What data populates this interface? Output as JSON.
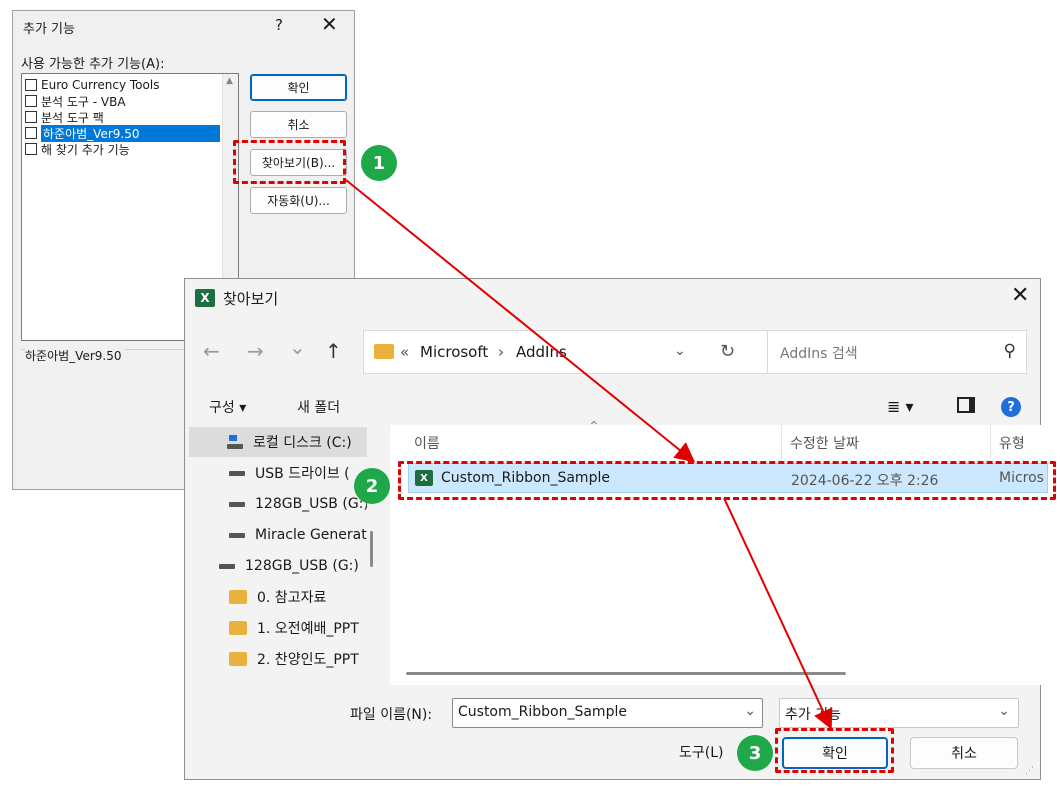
{
  "addins_dialog": {
    "title": "추가 기능",
    "help_symbol": "?",
    "close_symbol": "✕",
    "list_label": "사용 가능한 추가 기능(A):",
    "items": [
      {
        "label": "Euro Currency Tools",
        "checked": false,
        "selected": false
      },
      {
        "label": "분석 도구 - VBA",
        "checked": false,
        "selected": false
      },
      {
        "label": "분석 도구 팩",
        "checked": false,
        "selected": false
      },
      {
        "label": "하준아범_Ver9.50",
        "checked": false,
        "selected": true
      },
      {
        "label": "해 찾기 추가 기능",
        "checked": false,
        "selected": false
      }
    ],
    "description": "하준아범_Ver9.50",
    "buttons": {
      "ok": "확인",
      "cancel": "취소",
      "browse": "찾아보기(B)...",
      "automation": "자동화(U)..."
    }
  },
  "browse_dialog": {
    "title": "찾아보기",
    "app_icon_letter": "X",
    "close_symbol": "✕",
    "nav": {
      "back": "←",
      "forward": "→",
      "recent": "⌄",
      "up": "↑",
      "refresh": "↻"
    },
    "address": {
      "overflow": "«",
      "path": [
        "Microsoft",
        "AddIns"
      ],
      "separator": "›"
    },
    "search_placeholder": "AddIns 검색",
    "toolbar": {
      "organize": "구성 ▾",
      "new_folder": "새 폴더"
    },
    "sidebar": [
      {
        "label": "로컬 디스크 (C:)",
        "type": "local",
        "selected": true,
        "indent": 1
      },
      {
        "label": "USB 드라이브 (",
        "type": "drive",
        "selected": false,
        "indent": 1
      },
      {
        "label": "128GB_USB (G:)",
        "type": "drive",
        "selected": false,
        "indent": 1
      },
      {
        "label": "Miracle Generat",
        "type": "drive",
        "selected": false,
        "indent": 1
      },
      {
        "label": "128GB_USB (G:)",
        "type": "drive",
        "selected": false,
        "indent": 0
      },
      {
        "label": "0. 참고자료",
        "type": "folder",
        "selected": false,
        "indent": 1
      },
      {
        "label": "1. 오전예배_PPT",
        "type": "folder",
        "selected": false,
        "indent": 1
      },
      {
        "label": "2. 찬양인도_PPT",
        "type": "folder",
        "selected": false,
        "indent": 1
      }
    ],
    "columns": {
      "name": "이름",
      "modified": "수정한 날짜",
      "type": "유형"
    },
    "files": [
      {
        "name": "Custom_Ribbon_Sample",
        "modified": "2024-06-22 오후 2:26",
        "type": "Micros"
      }
    ],
    "filename_label": "파일 이름(N):",
    "filename_value": "Custom_Ribbon_Sample",
    "filetype_value": "추가 기능",
    "tools_label": "도구(L)",
    "ok": "확인",
    "cancel": "취소"
  },
  "annotations": {
    "badges": [
      "1",
      "2",
      "3"
    ],
    "highlight_color": "#e00000",
    "badge_color": "#1ea848"
  },
  "colors": {
    "selection": "#0078d7",
    "row_selection": "#cce8ff",
    "excel_green": "#1d6f42",
    "folder": "#e8b23c",
    "accent": "#0067c0"
  }
}
